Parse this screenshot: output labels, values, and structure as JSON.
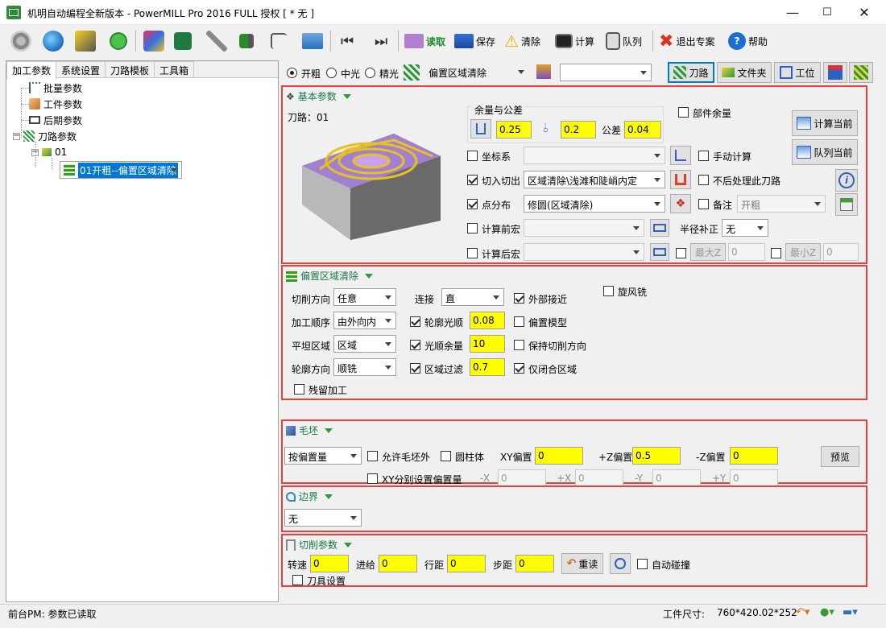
{
  "window": {
    "title": "机明自动编程全新版本 - PowerMILL Pro 2016 FULL 授权    [ * 无 ]",
    "minimize": "—",
    "maximize": "☐",
    "close": "✕"
  },
  "toolbar": {
    "read": "读取",
    "save": "保存",
    "clear": "清除",
    "compute": "计算",
    "queue": "队列",
    "exit_expert": "退出专案",
    "help": "帮助"
  },
  "left_tabs": [
    "加工参数",
    "系统设置",
    "刀路模板",
    "工具箱"
  ],
  "tree": {
    "batch": "批量参数",
    "workpiece": "工件参数",
    "post": "后期参数",
    "toolpath": "刀路参数",
    "node01": "01",
    "node01_child": "01开粗--偏置区域清除"
  },
  "topbar": {
    "roughing": "开粗",
    "semi": "中光",
    "finish": "精光",
    "strategy": "偏置区域清除",
    "combo_value": "",
    "toolpath_btn": "刀路",
    "folder_btn": "文件夹",
    "workpos_btn": "工位"
  },
  "basic": {
    "title": "基本参数",
    "toolpath_label": "刀路：01",
    "allowance_group": "余量与公差",
    "allowance_1": "0.25",
    "allowance_2": "0.2",
    "tolerance_label": "公差",
    "tolerance": "0.04",
    "part_allowance": "部件余量",
    "calc_current": "计算当前",
    "queue_current": "队列当前",
    "coord": "坐标系",
    "manual_calc": "手动计算",
    "lead_inout": "切入切出",
    "lead_value": "区域清除\\浅滩和陡峭内定",
    "no_post": "不后处理此刀路",
    "point_dist": "点分布",
    "point_value": "修圆(区域清除)",
    "note": "备注",
    "note_value": "开粗",
    "pre_macro": "计算前宏",
    "radius_comp": "半径补正",
    "radius_value": "无",
    "post_macro": "计算后宏",
    "maxz_btn": "最大Z",
    "maxz": "0",
    "minz_btn": "最小Z",
    "minz": "0"
  },
  "offset": {
    "title": "偏置区域清除",
    "cut_dir": "切削方向",
    "cut_dir_value": "任意",
    "link": "连接",
    "link_value": "直",
    "outer_approach": "外部接近",
    "whirl": "旋风铣",
    "order": "加工顺序",
    "order_value": "由外向内",
    "profile_smooth": "轮廓光顺",
    "profile_smooth_value": "0.08",
    "offset_model": "偏置模型",
    "flat": "平坦区域",
    "flat_value": "区域",
    "smooth_allow": "光顺余量",
    "smooth_allow_value": "10",
    "keep_dir": "保持切削方向",
    "profile_dir": "轮廓方向",
    "profile_dir_value": "顺铣",
    "area_filter": "区域过滤",
    "area_filter_value": "0.7",
    "closed_only": "仅闭合区域",
    "rest": "残留加工"
  },
  "stock": {
    "title": "毛坯",
    "type": "按偏置量",
    "allow_outside": "允许毛坯外",
    "cylinder": "圆柱体",
    "xy_offset": "XY偏置",
    "xy_value": "0",
    "zplus": "+Z偏置",
    "zplus_value": "0.5",
    "zminus": "-Z偏置",
    "zminus_value": "0",
    "preview": "预览",
    "xy_separate": "XY分别设置偏置量",
    "mx": "-X",
    "mx_v": "0",
    "px": "+X",
    "px_v": "0",
    "my": "-Y",
    "my_v": "0",
    "py": "+Y",
    "py_v": "0"
  },
  "boundary": {
    "title": "边界",
    "value": "无"
  },
  "cutting": {
    "title": "切削参数",
    "speed": "转速",
    "speed_v": "0",
    "feed": "进给",
    "feed_v": "0",
    "stepover": "行距",
    "stepover_v": "0",
    "stepdown": "步距",
    "stepdown_v": "0",
    "reread": "重读",
    "auto_collision": "自动碰撞",
    "tool_setting": "刀具设置"
  },
  "status": {
    "left": "前台PM: 参数已读取",
    "size_label": "工件尺寸:",
    "size_value": "760*420.02*252"
  }
}
